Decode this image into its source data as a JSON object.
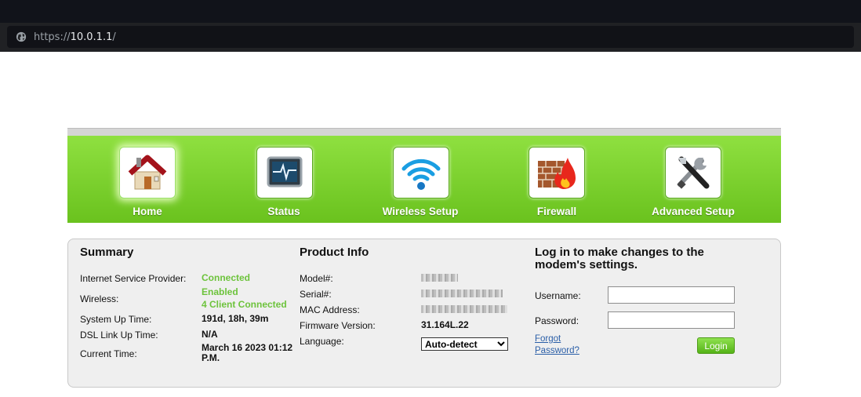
{
  "browser": {
    "url_scheme": "https://",
    "url_host": "10.0.1.1",
    "url_path": "/"
  },
  "nav": {
    "items": [
      {
        "label": "Home",
        "icon": "house-icon",
        "active": true
      },
      {
        "label": "Status",
        "icon": "monitor-pulse-icon"
      },
      {
        "label": "Wireless Setup",
        "icon": "wifi-icon"
      },
      {
        "label": "Firewall",
        "icon": "firewall-icon"
      },
      {
        "label": "Advanced Setup",
        "icon": "tools-icon"
      }
    ]
  },
  "summary": {
    "title": "Summary",
    "isp_label": "Internet Service Provider:",
    "isp_value": "Connected",
    "wireless_label": "Wireless:",
    "wireless_value": "Enabled",
    "wireless_clients": "4 Client Connected",
    "uptime_label": "System Up Time:",
    "uptime_value": "191d, 18h, 39m",
    "dsl_label": "DSL Link Up Time:",
    "dsl_value": "N/A",
    "time_label": "Current Time:",
    "time_value": "March 16 2023 01:12 P.M."
  },
  "product": {
    "title": "Product Info",
    "model_label": "Model#:",
    "serial_label": "Serial#:",
    "mac_label": "MAC Address:",
    "firmware_label": "Firmware Version:",
    "firmware_value": "31.164L.22",
    "language_label": "Language:",
    "language_selected": "Auto-detect"
  },
  "login": {
    "title": "Log in to make changes to the modem's settings.",
    "username_label": "Username:",
    "password_label": "Password:",
    "username_value": "",
    "password_value": "",
    "forgot_line1": "Forgot",
    "forgot_line2": "Password?",
    "button_label": "Login"
  },
  "colors": {
    "accent": "#6dc33c",
    "nav_green": "#7ad22c",
    "link": "#2b5fa8"
  }
}
